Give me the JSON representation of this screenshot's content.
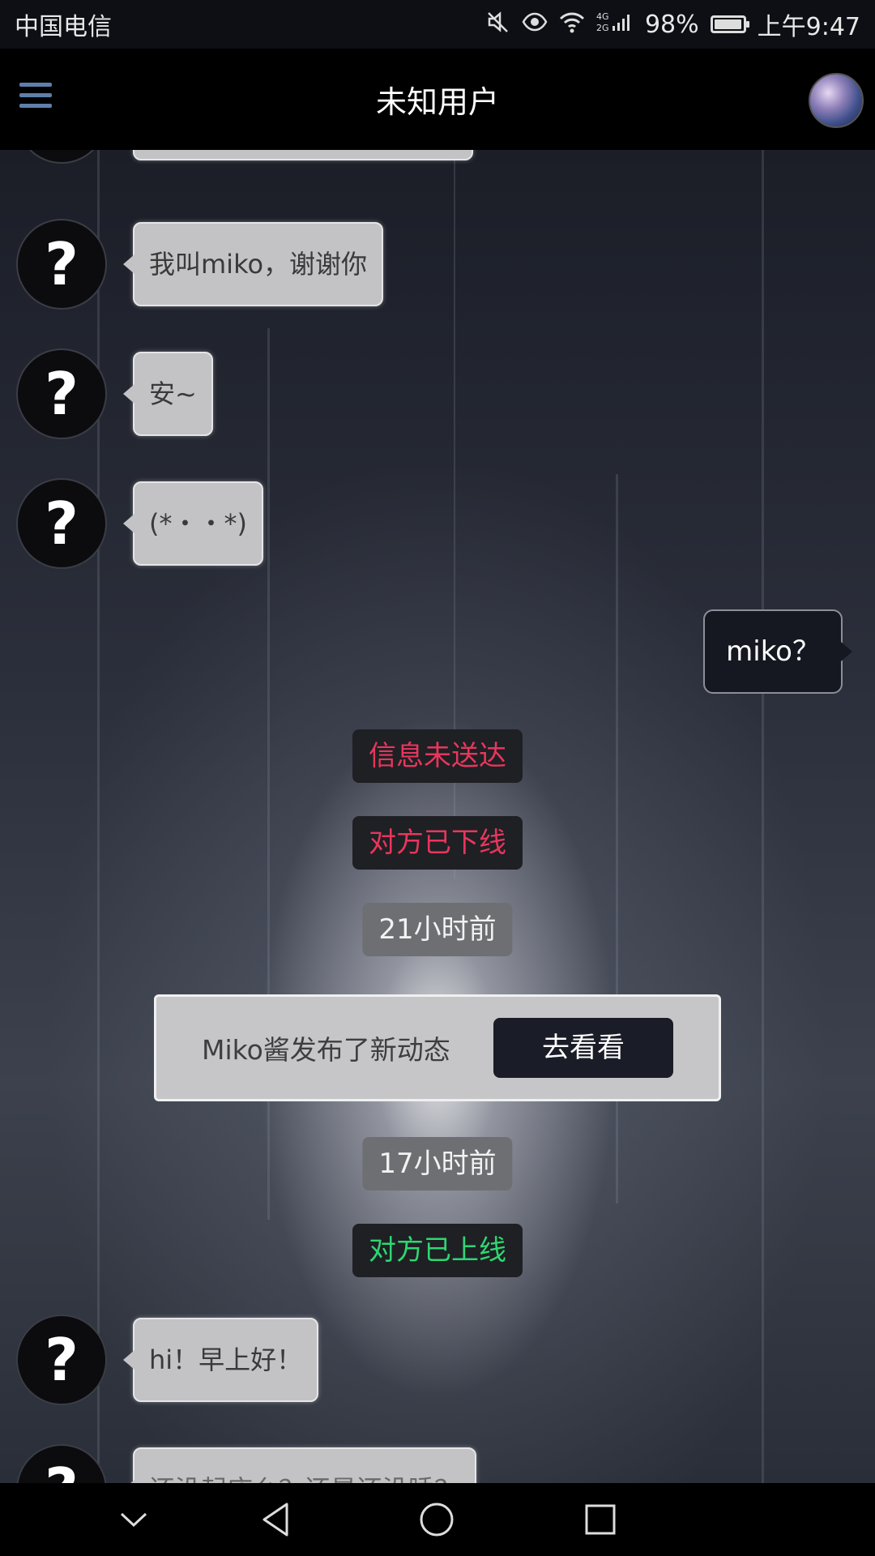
{
  "status_bar": {
    "carrier": "中国电信",
    "network": "4G 2G",
    "battery": "98%",
    "battery_level": 0.98,
    "time": "上午9:47",
    "icons": [
      "mute-icon",
      "eye-icon",
      "wifi-icon",
      "signal-icon",
      "battery-icon"
    ]
  },
  "header": {
    "title": "未知用户",
    "menu_icon": "hamburger-icon",
    "avatar_icon": "avatar"
  },
  "messages": {
    "m1": "我叫miko，谢谢你",
    "m2": "安~",
    "m3": "(*・・*)",
    "sent1": "miko？",
    "m4": "hi！早上好！",
    "m5_partial": "还没起床么？还是还没睡？",
    "unknown_avatar_symbol": "?"
  },
  "system": {
    "undelivered": "信息未送达",
    "offline": "对方已下线",
    "time1": "21小时前",
    "time2": "17小时前",
    "online": "对方已上线"
  },
  "notification": {
    "text": "Miko酱发布了新动态",
    "button": "去看看"
  },
  "colors": {
    "error": "#e8365c",
    "online": "#2fd672",
    "menu": "#5f7faa"
  },
  "nav": [
    "chevron-down-icon",
    "back-icon",
    "home-icon",
    "recent-apps-icon"
  ]
}
